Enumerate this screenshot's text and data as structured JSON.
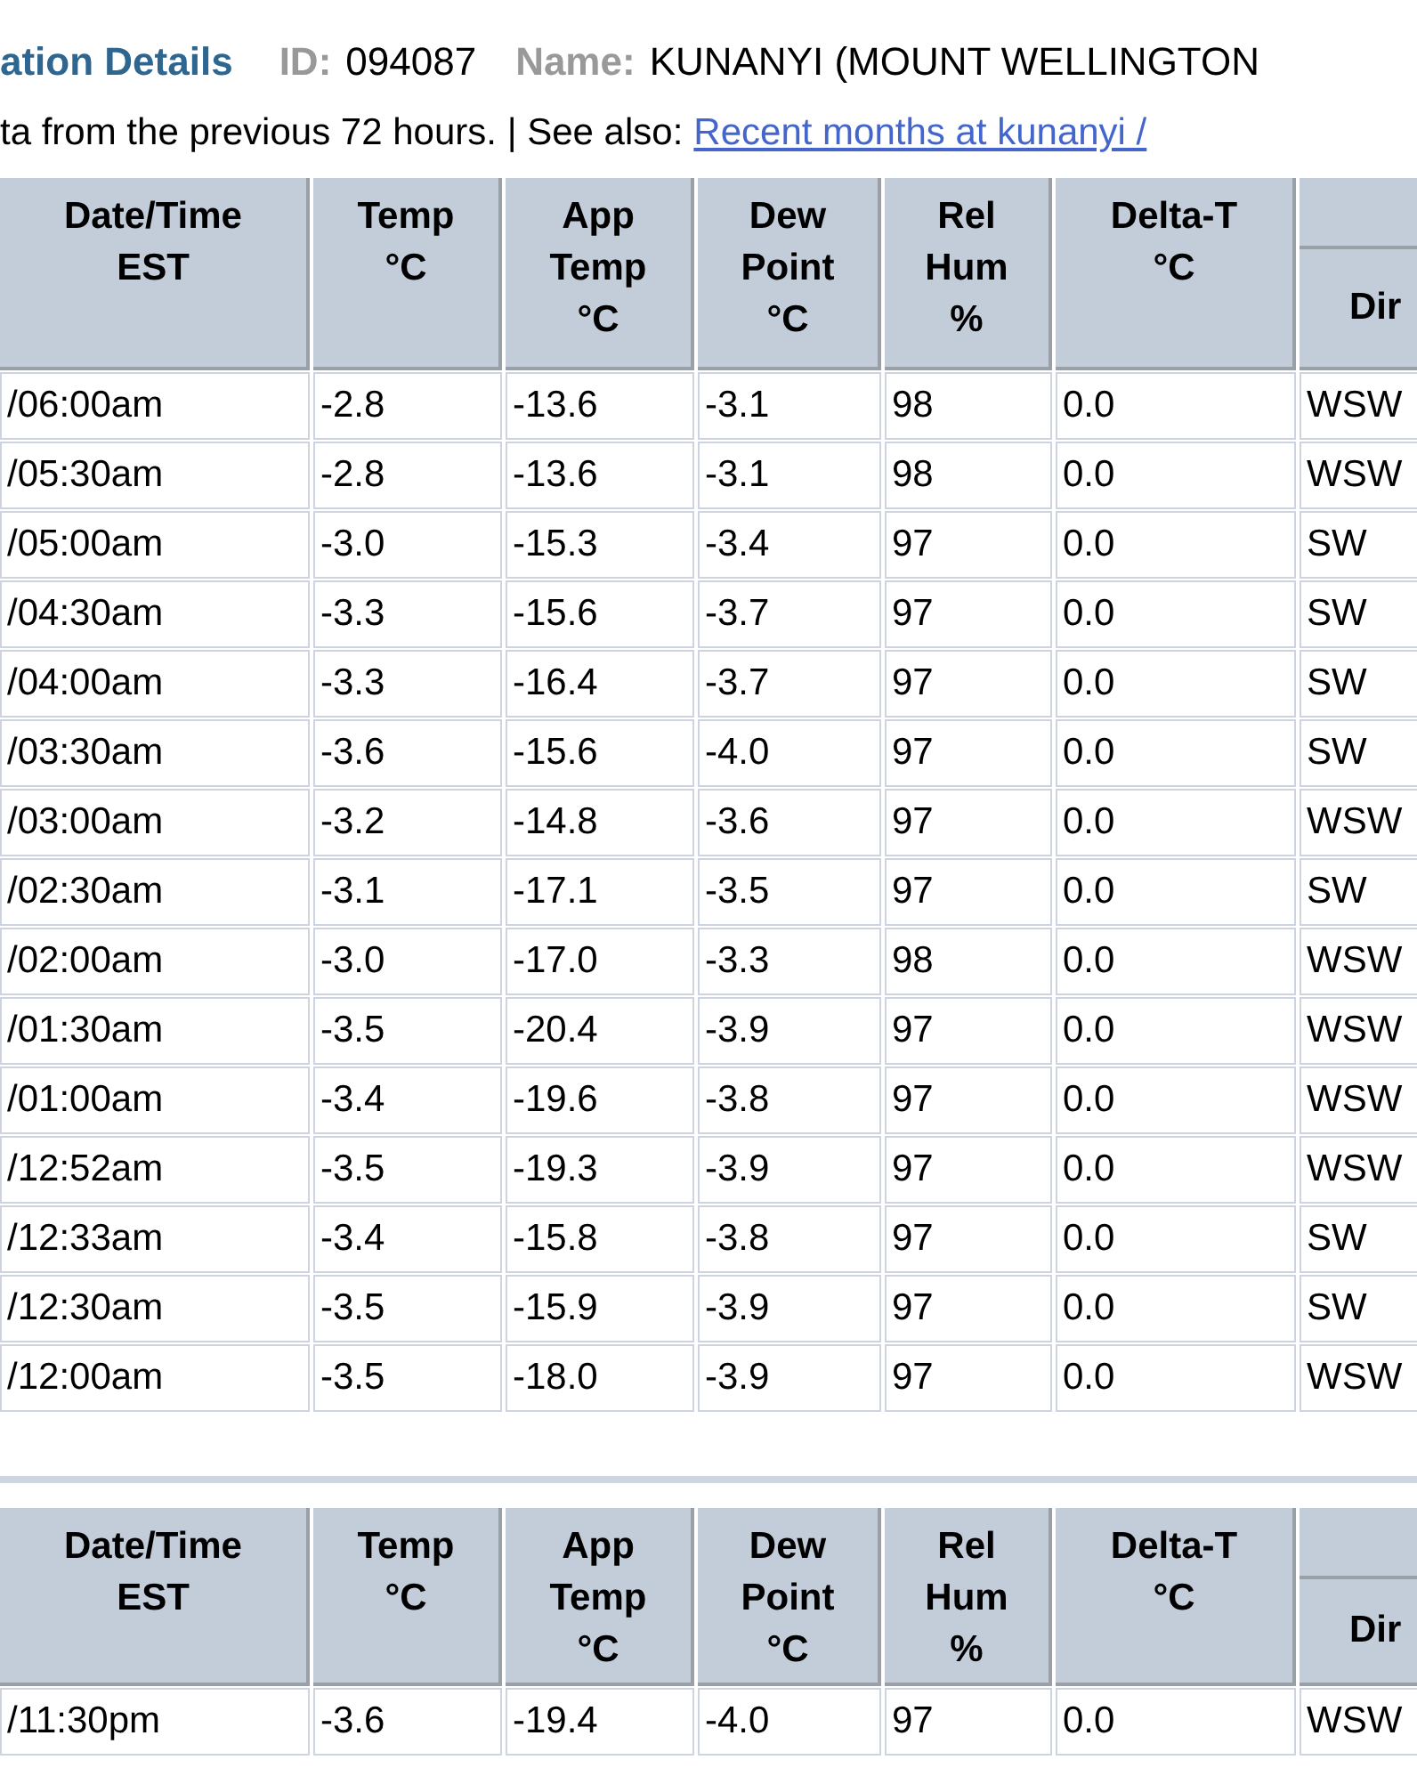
{
  "station": {
    "title": "ation Details",
    "id_label": "ID:",
    "id": "094087",
    "name_label": "Name:",
    "name": "KUNANYI (MOUNT WELLINGTON"
  },
  "notice": {
    "text": "ta from the previous 72 hours. | See also:",
    "link": "Recent months at kunanyi /"
  },
  "tables": [
    {
      "columns": [
        {
          "kind": "plain",
          "label": "Date/Time\nEST"
        },
        {
          "kind": "plain",
          "label": "Temp\n°C"
        },
        {
          "kind": "plain",
          "label": "App\nTemp\n°C"
        },
        {
          "kind": "plain",
          "label": "Dew\nPoint\n°C"
        },
        {
          "kind": "plain",
          "label": "Rel\nHum\n%"
        },
        {
          "kind": "plain",
          "label": "Delta-T\n°C"
        },
        {
          "kind": "grouped",
          "label": "Dir"
        }
      ],
      "rows": [
        [
          "/06:00am",
          "-2.8",
          "-13.6",
          "-3.1",
          "98",
          "0.0",
          "WSW"
        ],
        [
          "/05:30am",
          "-2.8",
          "-13.6",
          "-3.1",
          "98",
          "0.0",
          "WSW"
        ],
        [
          "/05:00am",
          "-3.0",
          "-15.3",
          "-3.4",
          "97",
          "0.0",
          "SW"
        ],
        [
          "/04:30am",
          "-3.3",
          "-15.6",
          "-3.7",
          "97",
          "0.0",
          "SW"
        ],
        [
          "/04:00am",
          "-3.3",
          "-16.4",
          "-3.7",
          "97",
          "0.0",
          "SW"
        ],
        [
          "/03:30am",
          "-3.6",
          "-15.6",
          "-4.0",
          "97",
          "0.0",
          "SW"
        ],
        [
          "/03:00am",
          "-3.2",
          "-14.8",
          "-3.6",
          "97",
          "0.0",
          "WSW"
        ],
        [
          "/02:30am",
          "-3.1",
          "-17.1",
          "-3.5",
          "97",
          "0.0",
          "SW"
        ],
        [
          "/02:00am",
          "-3.0",
          "-17.0",
          "-3.3",
          "98",
          "0.0",
          "WSW"
        ],
        [
          "/01:30am",
          "-3.5",
          "-20.4",
          "-3.9",
          "97",
          "0.0",
          "WSW"
        ],
        [
          "/01:00am",
          "-3.4",
          "-19.6",
          "-3.8",
          "97",
          "0.0",
          "WSW"
        ],
        [
          "/12:52am",
          "-3.5",
          "-19.3",
          "-3.9",
          "97",
          "0.0",
          "WSW"
        ],
        [
          "/12:33am",
          "-3.4",
          "-15.8",
          "-3.8",
          "97",
          "0.0",
          "SW"
        ],
        [
          "/12:30am",
          "-3.5",
          "-15.9",
          "-3.9",
          "97",
          "0.0",
          "SW"
        ],
        [
          "/12:00am",
          "-3.5",
          "-18.0",
          "-3.9",
          "97",
          "0.0",
          "WSW"
        ]
      ]
    },
    {
      "columns": [
        {
          "kind": "plain",
          "label": "Date/Time\nEST"
        },
        {
          "kind": "plain",
          "label": "Temp\n°C"
        },
        {
          "kind": "plain",
          "label": "App\nTemp\n°C"
        },
        {
          "kind": "plain",
          "label": "Dew\nPoint\n°C"
        },
        {
          "kind": "plain",
          "label": "Rel\nHum\n%"
        },
        {
          "kind": "plain",
          "label": "Delta-T\n°C"
        },
        {
          "kind": "grouped",
          "label": "Dir"
        }
      ],
      "rows": [
        [
          "/11:30pm",
          "-3.6",
          "-19.4",
          "-4.0",
          "97",
          "0.0",
          "WSW"
        ]
      ]
    }
  ]
}
